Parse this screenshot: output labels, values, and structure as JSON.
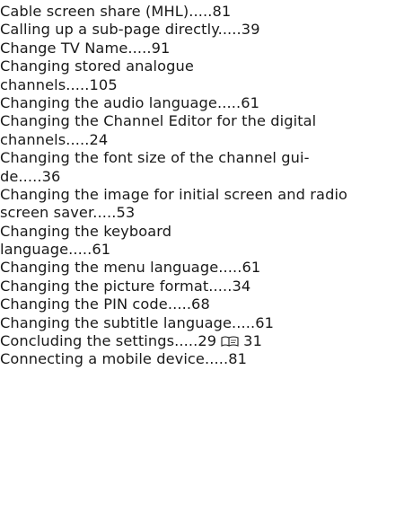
{
  "lines": [
    "Cable screen share (MHL).....81",
    "Calling up a sub-page directly.....39",
    "Change TV Name.....91",
    "Changing stored analogue",
    "channels.....105",
    "Changing the audio language.....61",
    "Changing the Channel Editor for the digital",
    "channels.....24",
    "Changing the font size of the channel gui-",
    "de.....36",
    "Changing the image for initial screen and radio",
    "screen saver.....53",
    "Changing the keyboard",
    "language.....61",
    "Changing the menu language.....61",
    "Changing the picture format.....34",
    "Changing the PIN code.....68",
    "Changing the subtitle language.....61",
    "Concluding the settings.....29",
    "Connecting a mobile device.....81"
  ],
  "concluding_extra": "31",
  "icons": {
    "concluding": "book-page-icon"
  }
}
